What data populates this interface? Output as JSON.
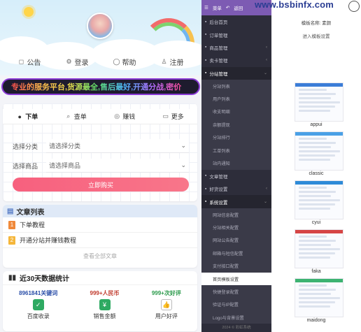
{
  "watermark": "www.bsbinfx.com",
  "mobile": {
    "nav": [
      "公告",
      "登录",
      "帮助",
      "注册"
    ],
    "ticker": "专业的服务平台,货源最全,售后最好,开通分战,密价",
    "tabs": [
      "下单",
      "查单",
      "赚钱",
      "更多"
    ],
    "select_category_label": "选择分类",
    "select_category_value": "请选择分类",
    "select_product_label": "选择商品",
    "select_product_value": "请选择商品",
    "buy_button": "立即购买",
    "articles": {
      "title": "文章列表",
      "items": [
        {
          "num": "1",
          "text": "下单教程",
          "color": "#f0893a"
        },
        {
          "num": "2",
          "text": "开通分站并赚钱教程",
          "color": "#f5b63a"
        }
      ],
      "more": "查看全部文章"
    },
    "stats": {
      "title": "近30天数据统计",
      "items": [
        {
          "value": "8961841关键词",
          "label": "百度收录",
          "color": "#2a4ea8",
          "icon": "check-icon"
        },
        {
          "value": "999+人民币",
          "label": "销售金额",
          "color": "#c0392b",
          "icon": "money-icon"
        },
        {
          "value": "999+次好评",
          "label": "用户好评",
          "color": "#2a9a4a",
          "icon": "thumbs-up-icon"
        }
      ]
    }
  },
  "admin": {
    "topbar": {
      "menu": "菜单",
      "back": "返回"
    },
    "menu": [
      {
        "type": "item",
        "label": "后台首页",
        "arrow": ""
      },
      {
        "type": "item",
        "label": "订单管理",
        "arrow": ""
      },
      {
        "type": "item",
        "label": "商品管理",
        "arrow": "‹"
      },
      {
        "type": "item",
        "label": "卖卡管理",
        "arrow": "‹"
      },
      {
        "type": "group",
        "label": "分站管理",
        "arrow": "⌄"
      },
      {
        "type": "sub",
        "label": "分站列表"
      },
      {
        "type": "sub",
        "label": "用户列表"
      },
      {
        "type": "sub",
        "label": "收支明细"
      },
      {
        "type": "sub",
        "label": "余额提现"
      },
      {
        "type": "sub",
        "label": "分站排行"
      },
      {
        "type": "sub",
        "label": "工单列表"
      },
      {
        "type": "sub",
        "label": "站内通知"
      },
      {
        "type": "item",
        "label": "文章管理",
        "arrow": ""
      },
      {
        "type": "item",
        "label": "好货设置",
        "arrow": "‹"
      },
      {
        "type": "group",
        "label": "系统设置",
        "arrow": "⌄"
      },
      {
        "type": "sub",
        "label": "网站信息配置"
      },
      {
        "type": "sub",
        "label": "分站相关配置"
      },
      {
        "type": "sub",
        "label": "网站公告配置"
      },
      {
        "type": "sub",
        "label": "邮箱与短信配置"
      },
      {
        "type": "sub",
        "label": "支付接口配置"
      },
      {
        "type": "sub",
        "label": "首页模板设置",
        "active": true
      },
      {
        "type": "sub",
        "label": "快捷登录配置"
      },
      {
        "type": "sub",
        "label": "验证与IP配置"
      },
      {
        "type": "sub",
        "label": "Logo与背景设置"
      }
    ],
    "footer": "2024 © 彩虹系统"
  },
  "templates": {
    "name_line": "模板名称: 素颜",
    "link": "进入模板设置",
    "items": [
      {
        "label": "appui",
        "accent": "#3b7dd8"
      },
      {
        "label": "classic",
        "accent": "#4aa0e6"
      },
      {
        "label": "cyui",
        "accent": "#2e8bd8"
      },
      {
        "label": "faka",
        "accent": "#d64545"
      },
      {
        "label": "maidong",
        "accent": "#3cb371"
      }
    ]
  }
}
